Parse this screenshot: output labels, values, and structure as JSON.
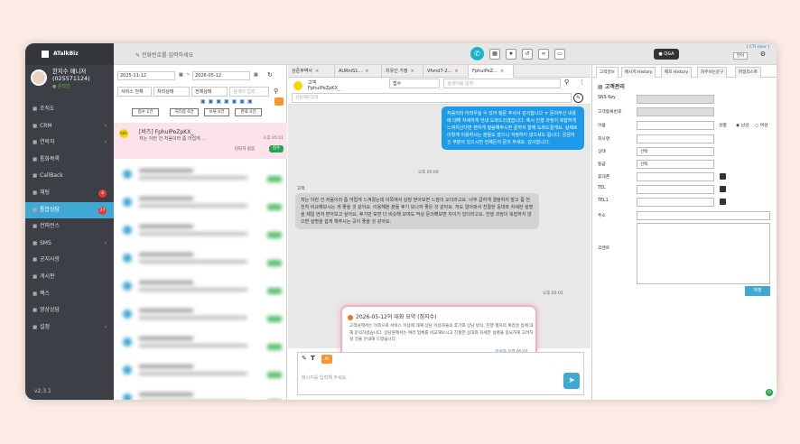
{
  "app": {
    "name": "ATalkBiz",
    "version": "v2.3.1"
  },
  "profile": {
    "name": "한지수 매니저",
    "phone": "(025571124)",
    "status": "온라인"
  },
  "menu": [
    {
      "label": "조직도",
      "icon": "org-icon"
    },
    {
      "label": "CRM",
      "icon": "crm-icon",
      "arrow": true
    },
    {
      "label": "연락처",
      "icon": "contact-icon",
      "arrow": true
    },
    {
      "label": "통화목록",
      "icon": "call-list-icon"
    },
    {
      "label": "CallBack",
      "icon": "callback-icon"
    },
    {
      "label": "채팅",
      "icon": "chat-icon",
      "badge": "4"
    },
    {
      "label": "통합상담",
      "icon": "consult-icon",
      "badge": "27",
      "active": true
    },
    {
      "label": "컨퍼런스",
      "icon": "conference-icon"
    },
    {
      "label": "SMS",
      "icon": "sms-icon",
      "arrow": true
    },
    {
      "label": "공지사항",
      "icon": "notice-icon"
    },
    {
      "label": "게시판",
      "icon": "board-icon"
    },
    {
      "label": "팩스",
      "icon": "fax-icon"
    },
    {
      "label": "영상상담",
      "icon": "video-icon"
    },
    {
      "label": "설정",
      "icon": "settings-icon",
      "arrow": true
    }
  ],
  "topbar": {
    "phone_placeholder": "전화번호를 입력하세요",
    "qna": "Q&A",
    "cti": "[ CTI User ]",
    "lang": "언어"
  },
  "filters": {
    "date_from": "2025-11-12",
    "date_to": "2026-05-12",
    "service": "서비스 전체",
    "process": "처리상태",
    "status": "전체상태",
    "search_placeholder": "검색어 입력",
    "counts": [
      "접수 1건",
      "처리중 0건",
      "보류 0건",
      "완료 0건"
    ]
  },
  "conversation": {
    "title": "[비즈] FphulPeZpKX_",
    "preview": "저는 이런 건 처음이라 좀 어렵게 ...",
    "time": "오후 05:01",
    "owner": "담당자 없음",
    "badge": "접수"
  },
  "chat": {
    "tabs": [
      "상준무역사",
      "AURnlS1...",
      "치유인 가정",
      "Vfvnd7-2...",
      "FphulPeZ..."
    ],
    "header_label": "고객",
    "header_id": "FphulPeZpKX_",
    "status_select": "접수",
    "search_placeholder": "검색어를 입력",
    "memo_placeholder": "상담메모입력",
    "msg_me": "처음이라 어려우실 수 있어 질문 주셔서 감사합니다 ㅠ 문의주신 내용에 대해 자세하게 안내 도와드리겠습니다. 혹시 진행 과정이 복잡하게 느껴지신다면 편하게 말씀해주시면 끝까지 함께 도와드릴게요. 실제로 이렇게 이용하시는 분들도 많으니 걱정하지 않으셔도 됩니다. 궁금하신 부분이 있으시면 언제든지 문의 주세요. 감사합니다.",
    "msg_me_time": "오후 05:00",
    "sender_label": "고객",
    "msg_you": "저는 이런 건 처음이라 좀 어렵게 느껴졌는데 이쪽에서 상담 받아보면 느낌이 오더라고요. 너무 급하게 결정하지 말고 좀 천천히 비교해보시는 게 좋을 것 같아요. 이용해본 분들 후기 보니까 좋은 것 같아요. 저도 알아봐서 친절한 응대와 자세한 설명을 제일 먼저 받아보고 싶어요. 후기만 보면 다 비슷해 보여도 막상 문의해보면 차이가 있더라고요. 진행 과정이 복잡하지 않으면 설명을 쉽게 해주시는 곳이 좋을 것 같아요.",
    "msg_you_time": "오후 05:01",
    "summary_title": "2026-05-12의 대화 요약 (정지수)",
    "summary_body": "고객님께서는 이쪽으로 서비스 이용에 대해 상담 이용자들의 후기와 상담 방식, 진행 절차의 복잡성 등에 대해 문의하셨습니다. 상담원께서는 여러 업체를 비교해보시고 친절한 응대와 자세한 설명을 중요하게 고려하실 것을 안내해 드렸습니다.",
    "summary_author": "작성자",
    "summary_time": "오후 05:01",
    "input_placeholder": "메시지를 입력해 주세요.",
    "ai_label": "AI"
  },
  "customer": {
    "tabs": [
      "고객정보",
      "메시지 History",
      "메모 History",
      "자주쓰는문구",
      "파일리스트"
    ],
    "title": "고객관리",
    "fields": {
      "sns_key": "SNS Key",
      "customer_no": "고객등록번호",
      "name": "이름",
      "gender": "성별",
      "male": "남성",
      "female": "여성",
      "company": "회사명",
      "status": "상태",
      "status_value": "선택",
      "grade": "등급",
      "grade_value": "선택",
      "mobile": "휴대폰",
      "tel": "TEL",
      "tel1": "TEL1",
      "address": "주소",
      "comment": "코멘트"
    },
    "save": "저장"
  }
}
